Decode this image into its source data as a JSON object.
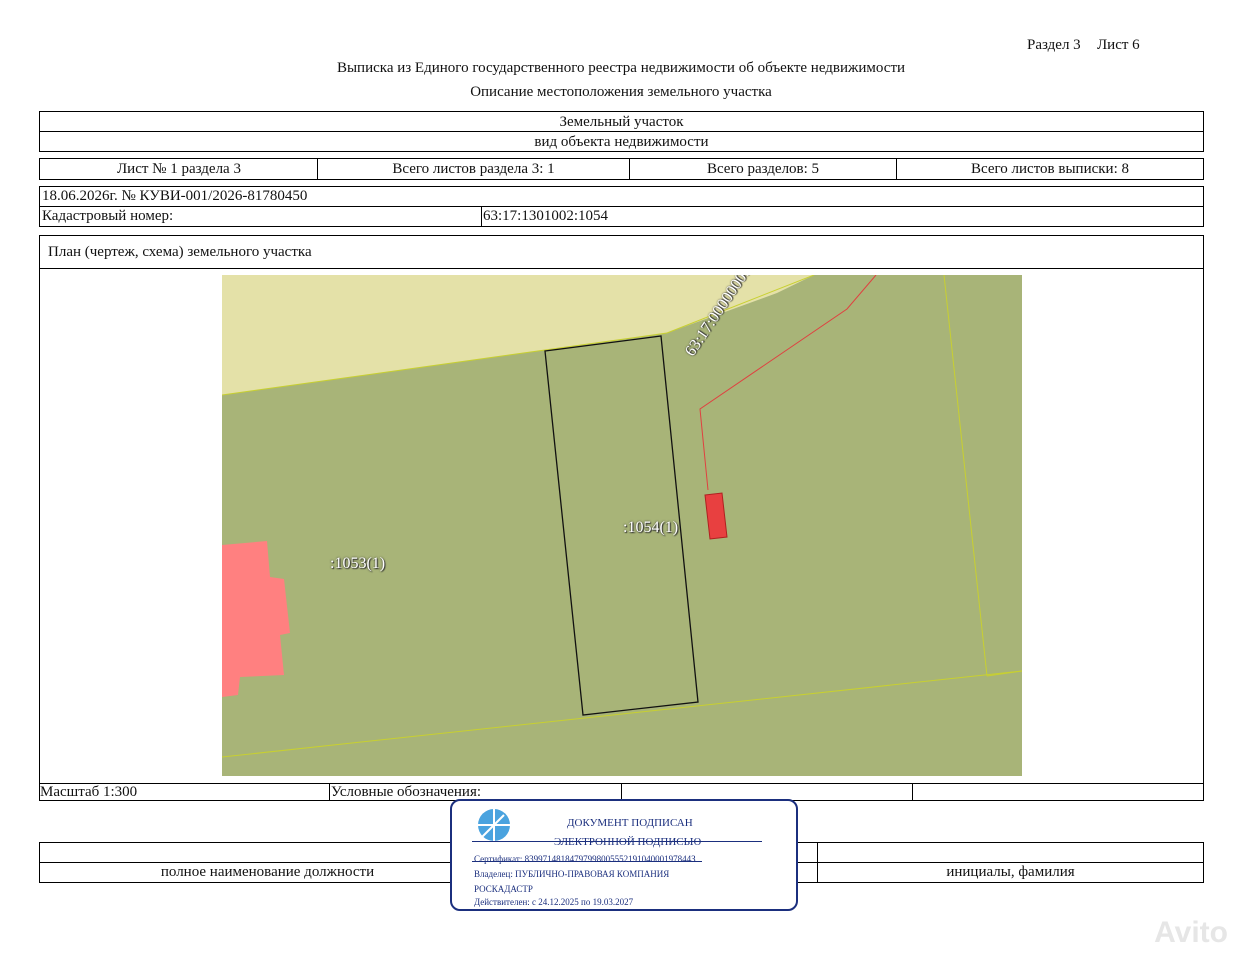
{
  "header": {
    "section": "Раздел 3",
    "sheet": "Лист 6",
    "title": "Выписка из Единого государственного реестра недвижимости об объекте недвижимости",
    "subtitle": "Описание местоположения земельного участка"
  },
  "object": {
    "type": "Земельный участок",
    "type_caption": "вид объекта недвижимости"
  },
  "sheets": {
    "sheet_of_section": "Лист № 1 раздела 3",
    "total_section_sheets": "Всего листов раздела 3: 1",
    "total_sections": "Всего разделов: 5",
    "total_extract_sheets": "Всего листов выписки: 8"
  },
  "doc": {
    "date_number": "18.06.2026г. № КУВИ-001/2026-81780450",
    "cadastral_label": "Кадастровый номер:",
    "cadastral_value": "63:17:1301002:1054"
  },
  "plan": {
    "title": "План (чертеж, схема) земельного участка",
    "labels": {
      "parcel_1054": ":1054(1)",
      "parcel_1053": ":1053(1)",
      "road": "63:17:0000000:6849"
    }
  },
  "footer": {
    "scale": "Масштаб 1:300",
    "legend": "Условные обозначения:",
    "position_caption": "полное наименование должности",
    "name_caption": "инициалы, фамилия"
  },
  "stamp": {
    "line1": "ДОКУМЕНТ ПОДПИСАН",
    "line2": "ЭЛЕКТРОННОЙ ПОДПИСЬЮ",
    "certificate": "Сертификат: 8399714818479799800555219104000197844З",
    "owner": "Владелец: ПУБЛИЧНО-ПРАВОВАЯ КОМПАНИЯ",
    "owner2": "РОСКАДАСТР",
    "valid": "Действителен: с 24.12.2025 по 19.03.2027"
  },
  "watermark": "Avito",
  "colors": {
    "map_green": "#a8b478",
    "map_yellow": "#e4e1a8",
    "building_pink": "#ff8080",
    "building_red": "#e84040",
    "stamp_blue": "#1b2f7e"
  }
}
